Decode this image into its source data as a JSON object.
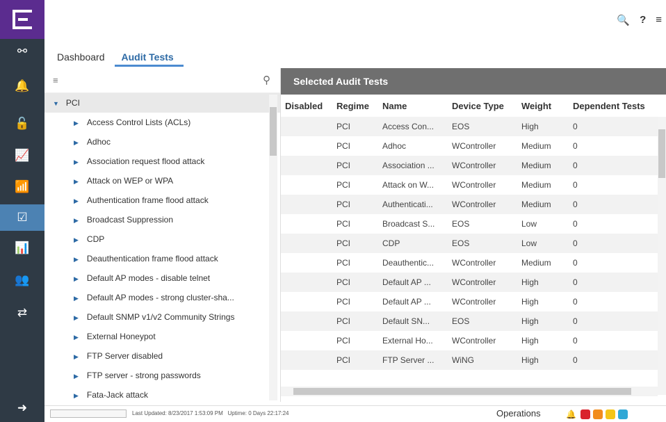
{
  "colors": {
    "sidebar_bg": "#2f3a45",
    "logo_bg": "#5b2c8f",
    "active_nav": "#4c82b3",
    "panel_header_bg": "#6f6f6f",
    "tab_active": "#2d6aa5"
  },
  "sidebar": {
    "items": [
      {
        "icon": "network-icon",
        "glyph": "⚯"
      },
      {
        "icon": "bell-icon",
        "glyph": "🔔"
      },
      {
        "icon": "lock-icon",
        "glyph": "🔓"
      },
      {
        "icon": "chart-line-icon",
        "glyph": "📈"
      },
      {
        "icon": "wifi-icon",
        "glyph": "📶"
      },
      {
        "icon": "checkbox-icon",
        "glyph": "☑",
        "active": true
      },
      {
        "icon": "bar-chart-icon",
        "glyph": "📊"
      },
      {
        "icon": "users-icon",
        "glyph": "👥"
      },
      {
        "icon": "transfer-icon",
        "glyph": "⇄"
      },
      {
        "icon": "arrow-right-icon",
        "glyph": "➜"
      }
    ]
  },
  "topbar": {
    "search_glyph": "🔍",
    "help_glyph": "?",
    "menu_glyph": "≡"
  },
  "tabs": [
    {
      "label": "Dashboard"
    },
    {
      "label": "Audit Tests"
    }
  ],
  "tree": {
    "root": "PCI",
    "children": [
      "Access Control Lists (ACLs)",
      "Adhoc",
      "Association request flood attack",
      "Attack on WEP or WPA",
      "Authentication frame flood attack",
      "Broadcast Suppression",
      "CDP",
      "Deauthentication frame flood attack",
      "Default AP modes - disable telnet",
      "Default AP modes - strong cluster-sha...",
      "Default SNMP v1/v2 Community Strings",
      "External Honeypot",
      "FTP Server disabled",
      "FTP server - strong passwords",
      "Fata-Jack attack"
    ]
  },
  "panel": {
    "title": "Selected Audit Tests",
    "columns": [
      "Disabled",
      "Regime",
      "Name",
      "Device Type",
      "Weight",
      "Dependent Tests"
    ],
    "rows": [
      [
        "",
        "PCI",
        "Access Con...",
        "EOS",
        "High",
        "0"
      ],
      [
        "",
        "PCI",
        "Adhoc",
        "WController",
        "Medium",
        "0"
      ],
      [
        "",
        "PCI",
        "Association ...",
        "WController",
        "Medium",
        "0"
      ],
      [
        "",
        "PCI",
        "Attack on W...",
        "WController",
        "Medium",
        "0"
      ],
      [
        "",
        "PCI",
        "Authenticati...",
        "WController",
        "Medium",
        "0"
      ],
      [
        "",
        "PCI",
        "Broadcast S...",
        "EOS",
        "Low",
        "0"
      ],
      [
        "",
        "PCI",
        "CDP",
        "EOS",
        "Low",
        "0"
      ],
      [
        "",
        "PCI",
        "Deauthentic...",
        "WController",
        "Medium",
        "0"
      ],
      [
        "",
        "PCI",
        "Default AP ...",
        "WController",
        "High",
        "0"
      ],
      [
        "",
        "PCI",
        "Default AP ...",
        "WController",
        "High",
        "0"
      ],
      [
        "",
        "PCI",
        "Default SN...",
        "EOS",
        "High",
        "0"
      ],
      [
        "",
        "PCI",
        "External Ho...",
        "WController",
        "High",
        "0"
      ],
      [
        "",
        "PCI",
        "FTP Server ...",
        "WiNG",
        "High",
        "0"
      ]
    ]
  },
  "status": {
    "last_updated": "Last Updated: 8/23/2017 1:53:09 PM",
    "uptime": "Uptime: 0 Days 22:17:24",
    "operations": "Operations",
    "badge_colors": [
      "#d9232d",
      "#f28c1d",
      "#f5c518",
      "#31a8d6"
    ]
  }
}
